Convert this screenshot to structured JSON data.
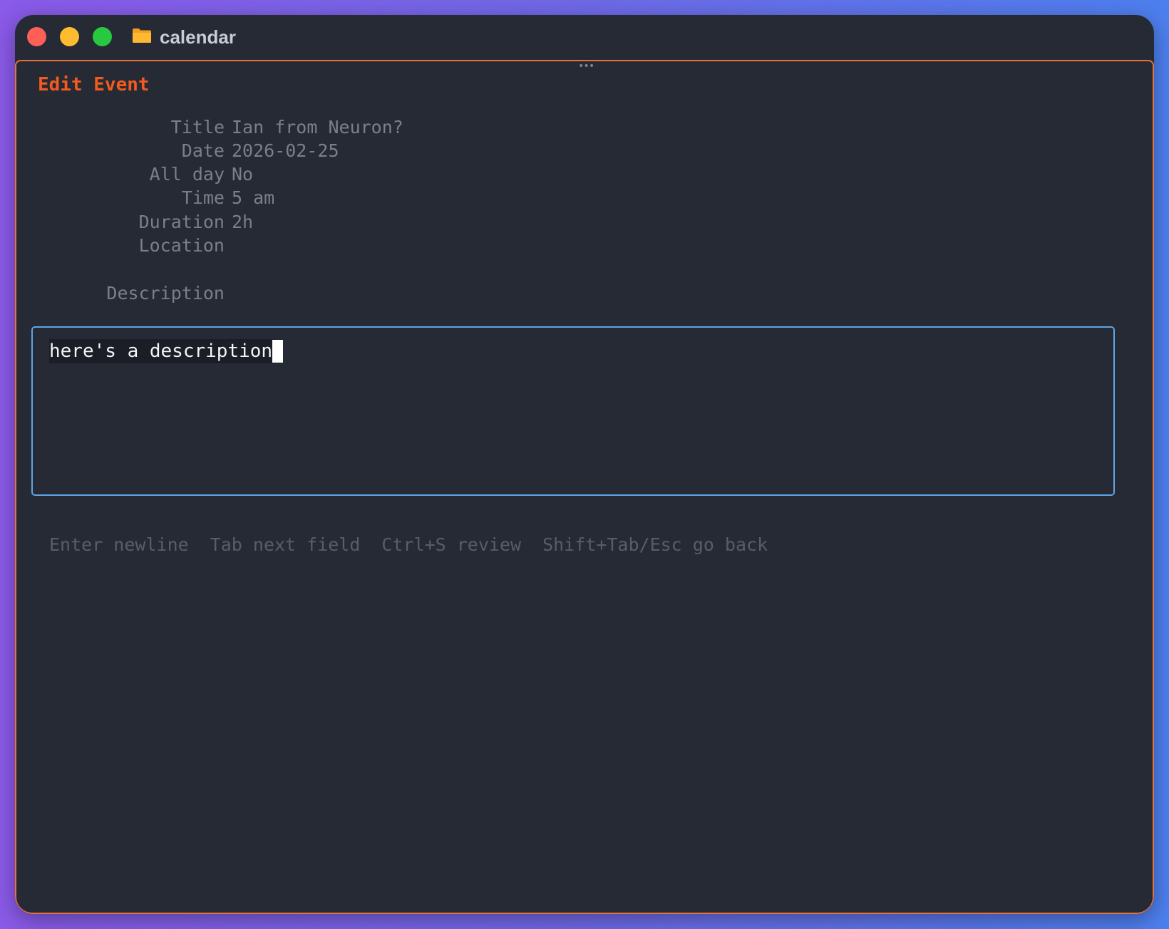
{
  "window": {
    "title": "calendar",
    "folder_icon": "folder-icon",
    "controls": [
      "close",
      "minimize",
      "zoom"
    ]
  },
  "form": {
    "heading": "Edit Event",
    "fields": [
      {
        "label": "Title",
        "value": "Ian from Neuron?"
      },
      {
        "label": "Date",
        "value": "2026-02-25"
      },
      {
        "label": "All day",
        "value": "No"
      },
      {
        "label": "Time",
        "value": "5 am"
      },
      {
        "label": "Duration",
        "value": "2h"
      },
      {
        "label": "Location",
        "value": ""
      }
    ],
    "description_label": "Description",
    "description_value": "here's a description"
  },
  "hints": [
    "Enter newline",
    "Tab next field",
    "Ctrl+S review",
    "Shift+Tab/Esc go back"
  ],
  "colors": {
    "accent": "#f25a1e",
    "pane_border": "#e8733a",
    "focus_border": "#5ea5e6",
    "background": "#262a35"
  }
}
